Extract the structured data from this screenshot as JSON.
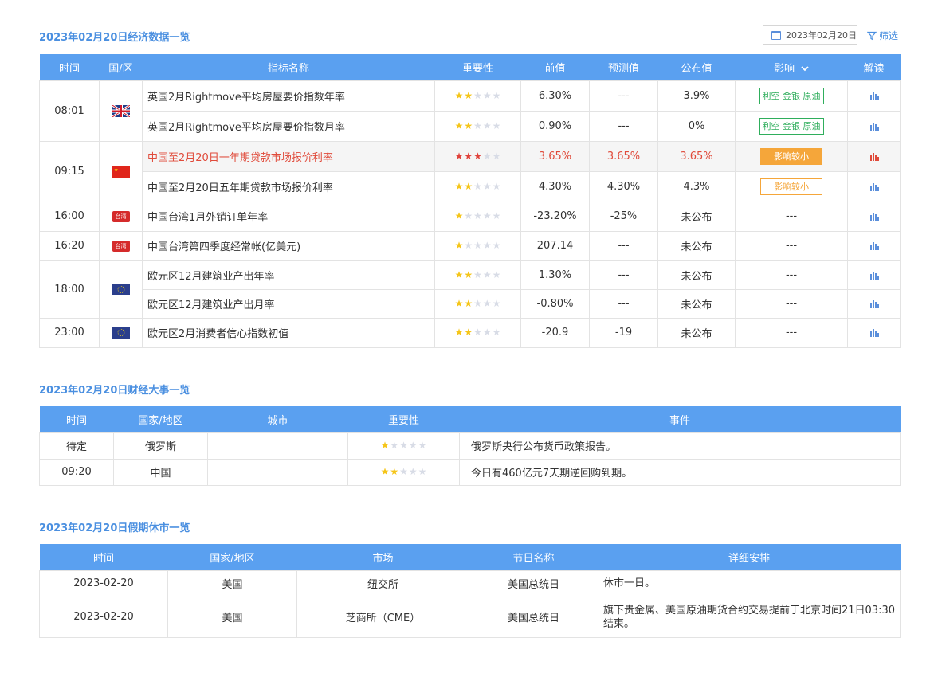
{
  "econ": {
    "title": "2023年02月20日经济数据一览",
    "date_picker": "2023年02月20日",
    "filter_label": "筛选",
    "headers": [
      "时间",
      "国/区",
      "指标名称",
      "重要性",
      "前值",
      "预测值",
      "公布值",
      "影响",
      "解读"
    ],
    "groups": [
      {
        "time": "08:01",
        "flag": "uk",
        "rows": [
          {
            "name": "英国2月Rightmove平均房屋要价指数年率",
            "stars": 2,
            "prev": "6.30%",
            "fcst": "---",
            "actual": "3.9%",
            "impact": "利空 金银 原油",
            "impact_type": "green",
            "highlight": false
          },
          {
            "name": "英国2月Rightmove平均房屋要价指数月率",
            "stars": 2,
            "prev": "0.90%",
            "fcst": "---",
            "actual": "0%",
            "impact": "利空 金银 原油",
            "impact_type": "green",
            "highlight": false
          }
        ]
      },
      {
        "time": "09:15",
        "flag": "cn",
        "rows": [
          {
            "name": "中国至2月20日一年期贷款市场报价利率",
            "stars": 3,
            "prev": "3.65%",
            "fcst": "3.65%",
            "actual": "3.65%",
            "impact": "影响较小",
            "impact_type": "solid",
            "highlight": true
          },
          {
            "name": "中国至2月20日五年期贷款市场报价利率",
            "stars": 2,
            "prev": "4.30%",
            "fcst": "4.30%",
            "actual": "4.3%",
            "impact": "影响较小",
            "impact_type": "outline",
            "highlight": false
          }
        ]
      },
      {
        "time": "16:00",
        "flag": "tw",
        "flag_text": "台湾",
        "rows": [
          {
            "name": "中国台湾1月外销订单年率",
            "stars": 1,
            "prev": "-23.20%",
            "fcst": "-25%",
            "actual": "未公布",
            "impact": "---",
            "impact_type": "none",
            "highlight": false
          }
        ]
      },
      {
        "time": "16:20",
        "flag": "tw",
        "flag_text": "台湾",
        "rows": [
          {
            "name": "中国台湾第四季度经常帐(亿美元)",
            "stars": 1,
            "prev": "207.14",
            "fcst": "---",
            "actual": "未公布",
            "impact": "---",
            "impact_type": "none",
            "highlight": false
          }
        ]
      },
      {
        "time": "18:00",
        "flag": "eu",
        "rows": [
          {
            "name": "欧元区12月建筑业产出年率",
            "stars": 2,
            "prev": "1.30%",
            "fcst": "---",
            "actual": "未公布",
            "impact": "---",
            "impact_type": "none",
            "highlight": false
          },
          {
            "name": "欧元区12月建筑业产出月率",
            "stars": 2,
            "prev": "-0.80%",
            "fcst": "---",
            "actual": "未公布",
            "impact": "---",
            "impact_type": "none",
            "highlight": false
          }
        ]
      },
      {
        "time": "23:00",
        "flag": "eu",
        "rows": [
          {
            "name": "欧元区2月消费者信心指数初值",
            "stars": 2,
            "prev": "-20.9",
            "fcst": "-19",
            "actual": "未公布",
            "impact": "---",
            "impact_type": "none",
            "highlight": false
          }
        ]
      }
    ]
  },
  "events": {
    "title": "2023年02月20日财经大事一览",
    "headers": [
      "时间",
      "国家/地区",
      "城市",
      "重要性",
      "事件"
    ],
    "rows": [
      {
        "time": "待定",
        "country": "俄罗斯",
        "city": "",
        "stars": 1,
        "event": "俄罗斯央行公布货币政策报告。"
      },
      {
        "time": "09:20",
        "country": "中国",
        "city": "",
        "stars": 2,
        "event": "今日有460亿元7天期逆回购到期。"
      }
    ]
  },
  "holidays": {
    "title": "2023年02月20日假期休市一览",
    "headers": [
      "时间",
      "国家/地区",
      "市场",
      "节日名称",
      "详细安排"
    ],
    "rows": [
      {
        "date": "2023-02-20",
        "country": "美国",
        "market": "纽交所",
        "holiday": "美国总统日",
        "detail": "休市一日。"
      },
      {
        "date": "2023-02-20",
        "country": "美国",
        "market": "芝商所（CME）",
        "holiday": "美国总统日",
        "detail": "旗下贵金属、美国原油期货合约交易提前于北京时间21日03:30结束。"
      }
    ]
  },
  "colors": {
    "header_bg": "#5aa0f0",
    "title": "#4a8fe0",
    "star_on": "#f5c518",
    "star_red": "#e0413a",
    "impact_green": "#2fae5c",
    "impact_orange": "#f5a63a"
  },
  "icons": {
    "calendar": "calendar-icon",
    "filter": "filter-icon",
    "chart": "bar-chart-icon",
    "chevron": "chevron-down-icon"
  }
}
